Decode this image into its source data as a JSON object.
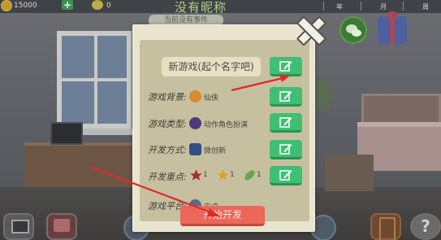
{
  "topbar": {
    "money": "15000",
    "fans": "0",
    "company_name": "没有昵称",
    "year_label": "年",
    "month_label": "月",
    "week_label": "周"
  },
  "background": {
    "tooltip": "当前没有事件"
  },
  "dialog": {
    "game_name": "新游戏(起个名字吧)",
    "rows": [
      {
        "label": "游戏背景:",
        "value": "仙侠",
        "icon": "sword-icon"
      },
      {
        "label": "游戏类型:",
        "value": "动作角色扮演",
        "icon": "gamepad-icon"
      },
      {
        "label": "开发方式:",
        "value": "微创新",
        "icon": "monitor-icon"
      },
      {
        "label": "开发重点:",
        "values": [
          "1",
          "1",
          "1"
        ],
        "icons": [
          "star-red-icon",
          "star-gold-icon",
          "leaf-green-icon"
        ]
      },
      {
        "label": "游戏平台:",
        "value": "安卓",
        "icon": "android-icon"
      }
    ],
    "start_label": "开始开发"
  },
  "colors": {
    "edit_button": "#3fbf72",
    "start_button": "#ea675a",
    "annotation_arrow": "#e02828"
  },
  "bottombar": {
    "help_label": "?"
  }
}
